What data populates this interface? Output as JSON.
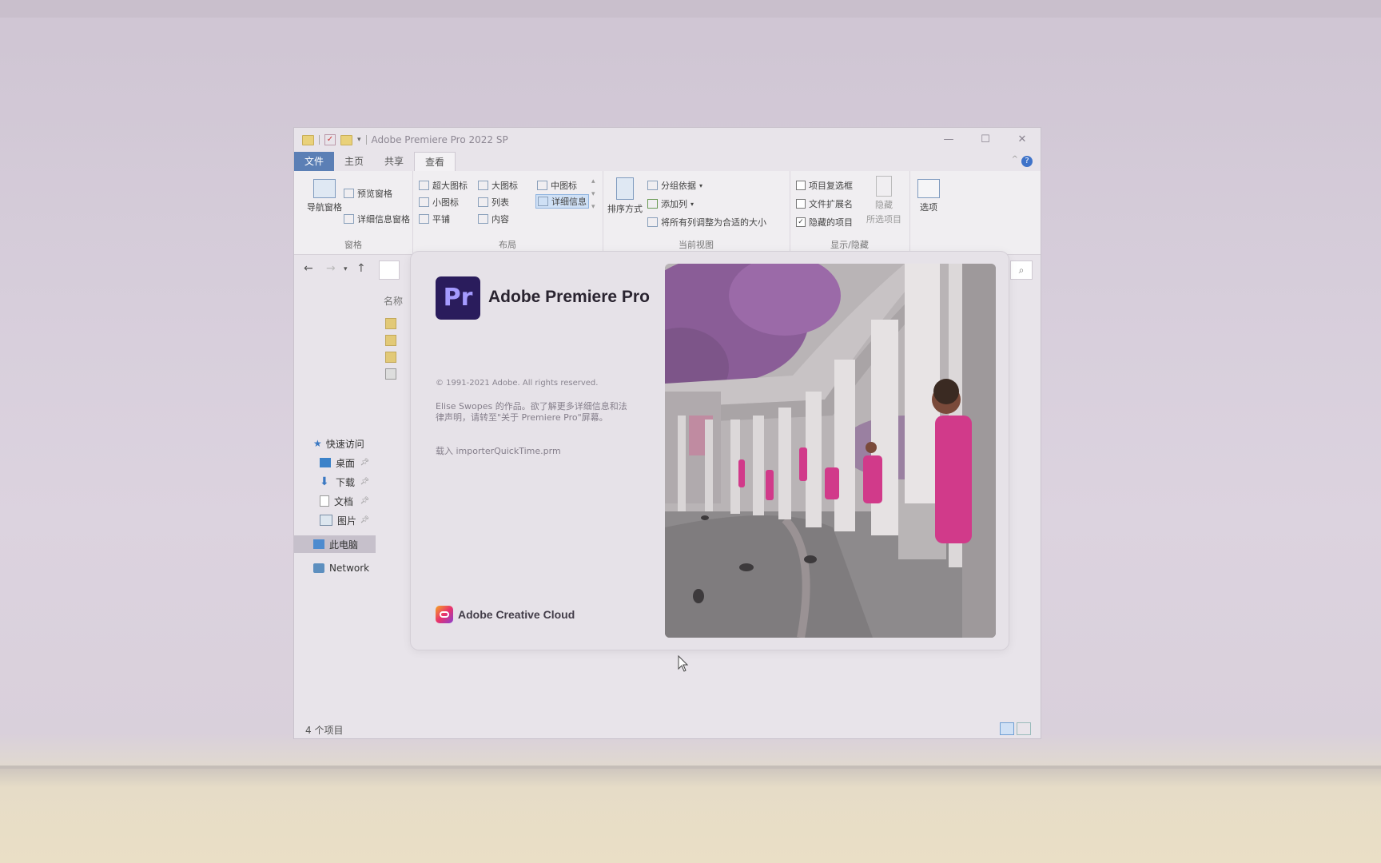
{
  "window": {
    "title": "Adobe Premiere Pro 2022 SP",
    "controls": {
      "minimize": "—",
      "maximize": "☐",
      "close": "✕"
    }
  },
  "ribbon": {
    "tabs": [
      "文件",
      "主页",
      "共享",
      "查看"
    ],
    "active_tab": "查看",
    "help": "?",
    "panes": {
      "label": "窗格",
      "nav_pane": "导航窗格",
      "preview_pane": "预览窗格",
      "details_pane": "详细信息窗格"
    },
    "layout": {
      "label": "布局",
      "options": [
        "超大图标",
        "大图标",
        "中图标",
        "小图标",
        "列表",
        "详细信息",
        "平铺",
        "内容"
      ],
      "selected": "详细信息"
    },
    "current_view": {
      "label": "当前视图",
      "sort": "排序方式",
      "group_by": "分组依据",
      "add_column": "添加列",
      "fit_columns": "将所有列调整为合适的大小"
    },
    "show_hide": {
      "label": "显示/隐藏",
      "item_checkboxes": "项目复选框",
      "file_extensions": "文件扩展名",
      "hidden_items": "隐藏的项目",
      "hide_selected": "隐藏",
      "hide_selected_sub": "所选项目",
      "options": "选项"
    }
  },
  "nav_pane": {
    "quick_access": "快速访问",
    "items": [
      "桌面",
      "下载",
      "文档",
      "图片"
    ],
    "this_pc": "此电脑",
    "network": "Network"
  },
  "file_list": {
    "column_name": "名称"
  },
  "status": {
    "count": "4 个项目"
  },
  "splash": {
    "logo_text": "Pr",
    "product": "Adobe Premiere Pro",
    "copyright": "© 1991-2021 Adobe. All rights reserved.",
    "credit": "Elise Swopes 的作品。欲了解更多详细信息和法律声明，请转至\"关于 Premiere Pro\"屏幕。",
    "loading": "载入 importerQuickTime.prm",
    "footer": "Adobe Creative Cloud"
  },
  "colors": {
    "premiere_logo_bg": "#2a1c5c",
    "premiere_logo_text": "#a59bff",
    "file_tab": "#5b7fb5",
    "accent_pink": "#d13a8a"
  }
}
